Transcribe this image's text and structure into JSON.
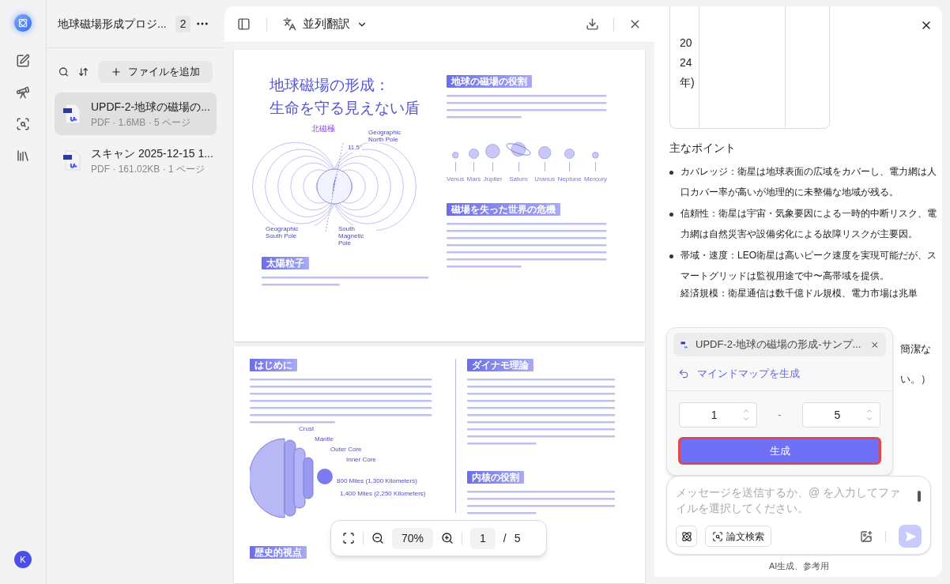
{
  "rail": {
    "avatar": "K"
  },
  "file_panel": {
    "title": "地球磁場形成プロジ...",
    "count": "2",
    "add_button": "ファイルを追加",
    "files": [
      {
        "name": "UPDF-2-地球の磁場の...",
        "meta": "PDF · 1.6MB · 5 ページ",
        "selected": true
      },
      {
        "name": "スキャン 2025-12-15 1...",
        "meta": "PDF · 161.02KB · 1 ページ",
        "selected": false
      }
    ]
  },
  "viewer": {
    "translate_label": "並列翻訳",
    "zoom": "70%",
    "page": "1",
    "page_separator": "/",
    "total": "5",
    "page1": {
      "title_lines": [
        "地球磁場の形成：",
        "生命を守る見えない盾"
      ],
      "magnet_labels": {
        "north_magnetic": "北磁極",
        "angle": "11.5°",
        "geo_north": "Geographic North Pole",
        "geo_south": "Geographic South Pole",
        "south_magnetic": "South Magnetic Pole"
      },
      "planets": [
        {
          "name": "Venus",
          "kind": "plain"
        },
        {
          "name": "Mars",
          "kind": "plain"
        },
        {
          "name": "Jupiter",
          "kind": "plain"
        },
        {
          "name": "Saturn",
          "kind": "ringed"
        },
        {
          "name": "Uranus",
          "kind": "plain"
        },
        {
          "name": "Neptune",
          "kind": "plain"
        },
        {
          "name": "Mercury",
          "kind": "plain"
        }
      ],
      "sections": [
        "地球の磁場の役割",
        "磁場を失った世界の危機",
        "太陽粒子"
      ]
    },
    "page2": {
      "sections": [
        "はじめに",
        "ダイナモ理論",
        "内核の役割",
        "歴史的視点"
      ],
      "core_labels": [
        "Crust",
        "Mantle",
        "Outer Core",
        "Inner Core"
      ],
      "distances": [
        "800 Miles (1,300 Kilometers)",
        "1,400 Miles (2,250 Kilometers)"
      ]
    }
  },
  "chat": {
    "table_cell": "2024年)",
    "heading": "主なポイント",
    "bullets": [
      "カバレッジ：衛星は地球表面の広域をカバーし、電力網は人口カバー率が高いが地理的に未整備な地域が残る。",
      "信頼性：衛星は宇宙・気象要因による一時的中断リスク、電力網は自然災害や設備劣化による故障リスクが主要因。",
      "帯域・速度：LEO衛星は高いピーク速度を実現可能だが、スマートグリッドは監視用途で中〜高帯域を提供。"
    ],
    "covered_line": "経済規模：衛星通信は数千億ドル規模、電力市場は兆単",
    "fragments": [
      "簡潔な",
      "い。）"
    ],
    "popup": {
      "file": "UPDF-2-地球の磁場の形成-サンプ...",
      "action": "マインドマップを生成",
      "from": "1",
      "dash": "-",
      "to": "5",
      "button": "生成",
      "highlighted": true
    },
    "input": {
      "placeholder": "メッセージを送信するか、@ を入力してファイルを選択してください。"
    },
    "paper_search": "論文検索",
    "footer": "AI生成、参考用"
  }
}
